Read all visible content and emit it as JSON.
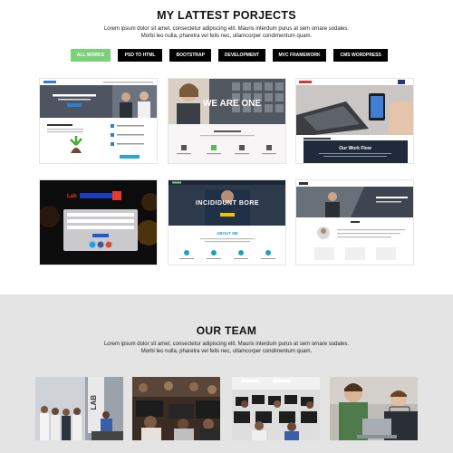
{
  "projects": {
    "title": "MY LATTEST PORJECTS",
    "description": "Lorem ipsum dolor sit amet, consectetur adipiscing elit. Mauris interdum purus at sem ornare sodales. Morbi leo nulla, pharetra vel felis nec, ullamcorper condimentum quam.",
    "filters": [
      {
        "label": "ALL WORKS",
        "active": true
      },
      {
        "label": "PSD TO HTML",
        "active": false
      },
      {
        "label": "BOOTSTRAP",
        "active": false
      },
      {
        "label": "DEVELOPMENT",
        "active": false
      },
      {
        "label": "MVC FRAMEWORK",
        "active": false
      },
      {
        "label": "CMS WORDPRESS",
        "active": false
      }
    ],
    "thumb2_text": "WE ARE ONE",
    "thumb3_panel": "Our Work Flow",
    "thumb5_text": "INCIDIDUNT BORE",
    "thumb5_about": "ABOUT ME"
  },
  "team": {
    "title": "OUR TEAM",
    "description": "Lorem ipsum dolor sit amet, consectetur adipiscing elit. Mauris interdum purus at sem ornare sodales. Morbi leo nulla, pharetra vel felis nec, ullamcorper condimentum quam.",
    "photo1_sign": "LAB"
  },
  "colors": {
    "accent": "#7cd07a",
    "filter_bg": "#000000",
    "team_bg": "#e4e4e4"
  }
}
